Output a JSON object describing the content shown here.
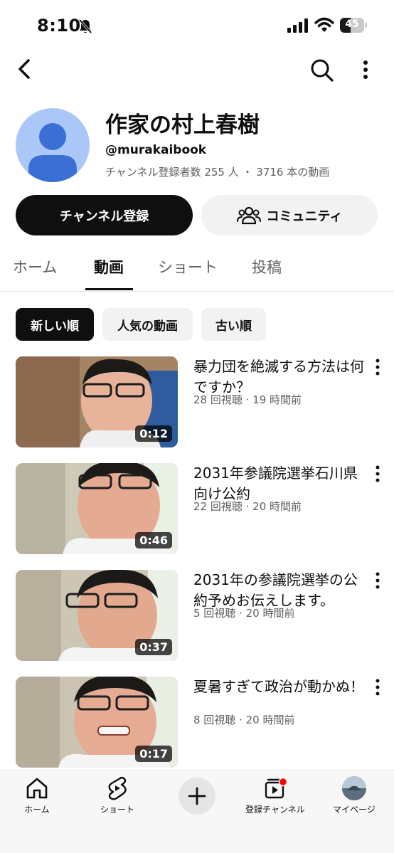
{
  "status_bar": {
    "time": "8:10",
    "battery": "45",
    "battery_level": 0.45
  },
  "channel": {
    "name": "作家の村上春樹",
    "handle": "@murakaibook",
    "stats": "チャンネル登録者数 255 人 ・ 3716 本の動画"
  },
  "actions": {
    "subscribe": "チャンネル登録",
    "community": "コミュニティ"
  },
  "tabs": [
    {
      "label": "ホーム",
      "active": false
    },
    {
      "label": "動画",
      "active": true
    },
    {
      "label": "ショート",
      "active": false
    },
    {
      "label": "投稿",
      "active": false
    }
  ],
  "chips": [
    {
      "label": "新しい順",
      "active": true
    },
    {
      "label": "人気の動画",
      "active": false
    },
    {
      "label": "古い順",
      "active": false
    }
  ],
  "videos": [
    {
      "title": "暴力団を絶滅する方法は何ですか？",
      "meta": "28 回視聴 · 19 時間前",
      "duration": "0:12"
    },
    {
      "title": "2031年参議院選挙石川県向け公約",
      "meta": "22 回視聴 · 20 時間前",
      "duration": "0:46"
    },
    {
      "title": "2031年の参議院選挙の公約予めお伝えします。",
      "meta": "5 回視聴 · 20 時間前",
      "duration": "0:37"
    },
    {
      "title": "夏暑すぎて政治が動かぬ！",
      "meta": "8 回視聴 · 20 時間前",
      "duration": "0:17"
    }
  ],
  "bottom_nav": {
    "home": "ホーム",
    "shorts": "ショート",
    "subscriptions": "登録チャンネル",
    "you": "マイページ"
  },
  "colors": {
    "text": "#0f0f0f",
    "secondary_text": "#606060",
    "chip_bg": "#f2f2f2",
    "avatar_bg": "#aac7f8",
    "avatar_fg": "#3b6fd6",
    "notification_dot": "#ff0000"
  },
  "icons": [
    "bell-slash-icon",
    "signal-icon",
    "wifi-icon",
    "battery-icon",
    "back-arrow-icon",
    "search-icon",
    "more-vertical-icon",
    "people-icon",
    "home-icon",
    "shorts-icon",
    "plus-icon",
    "subscriptions-icon"
  ]
}
